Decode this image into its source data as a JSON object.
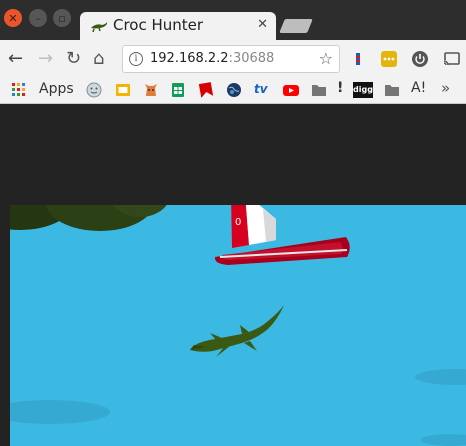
{
  "window": {
    "controls": [
      "close",
      "minimize",
      "maximize"
    ]
  },
  "tab": {
    "title": "Croc Hunter",
    "favicon": "crocodile-icon",
    "close_glyph": "✕"
  },
  "toolbar": {
    "back_glyph": "←",
    "forward_glyph": "→",
    "reload_glyph": "↻",
    "home_glyph": "⌂",
    "url_host": "192.168.2.2",
    "url_port": ":30688",
    "info_glyph": "i",
    "star_glyph": "☆"
  },
  "bookmarks": {
    "apps_label": "Apps",
    "items": [
      "smiley-icon",
      "slides-icon",
      "cat-icon",
      "sheets-icon",
      "bookmark-red-icon",
      "globe-icon",
      "tv-icon",
      "youtube-icon",
      "folder-icon",
      "exclamation-icon",
      "digg-icon",
      "folder-icon",
      "a-icon"
    ],
    "tv_label": "tv",
    "digg_label": "digg",
    "exclaim_label": "!",
    "a_label": "A!"
  },
  "colors": {
    "sea": "#3cb9e3",
    "boat_hull": "#a8001c",
    "croc": "#3a5a14",
    "trees": "#283c14",
    "page_bg": "#232323"
  },
  "game": {
    "boat_sail_label": "0"
  }
}
